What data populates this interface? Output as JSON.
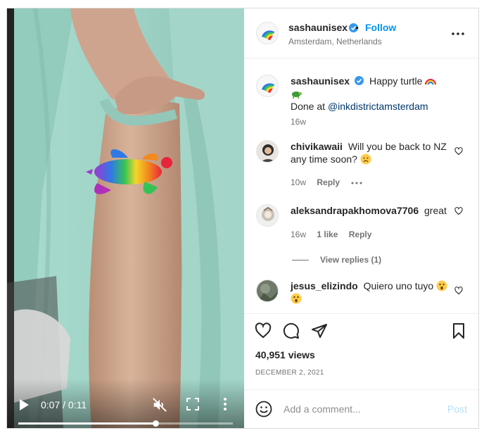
{
  "post": {
    "username": "sashaunisex",
    "follow_label": "Follow",
    "separator": "•",
    "location": "Amsterdam, Netherlands",
    "video": {
      "time": "0:07 / 0:11",
      "progress": 0.64
    }
  },
  "comments": [
    {
      "username": "sashaunisex",
      "verified": true,
      "text": "Happy turtle",
      "emojis": [
        "rainbow",
        "turtle"
      ],
      "text2": "Done at",
      "mention": "@inkdistrictamsterdam",
      "time": "16w"
    },
    {
      "username": "chivikawaii",
      "text": "Will you be back to NZ any time soon?",
      "emojis": [
        "frowning-face"
      ],
      "time": "10w",
      "reply_label": "Reply"
    },
    {
      "username": "aleksandrapakhomova7706",
      "text": "great",
      "time": "16w",
      "likes": "1 like",
      "reply_label": "Reply",
      "view_replies": "View replies (1)"
    },
    {
      "username": "jesus_elizindo",
      "text": "Quiero uno tuyo",
      "emojis": [
        "astonished-face",
        "astonished-face"
      ]
    }
  ],
  "stats": {
    "views": "40,951 views",
    "date": "DECEMBER 2, 2021"
  },
  "composer": {
    "placeholder": "Add a comment...",
    "post_label": "Post"
  },
  "colors": {
    "link": "#0095f6",
    "verified": "#3897f0",
    "dress": "#9fd3c7"
  }
}
